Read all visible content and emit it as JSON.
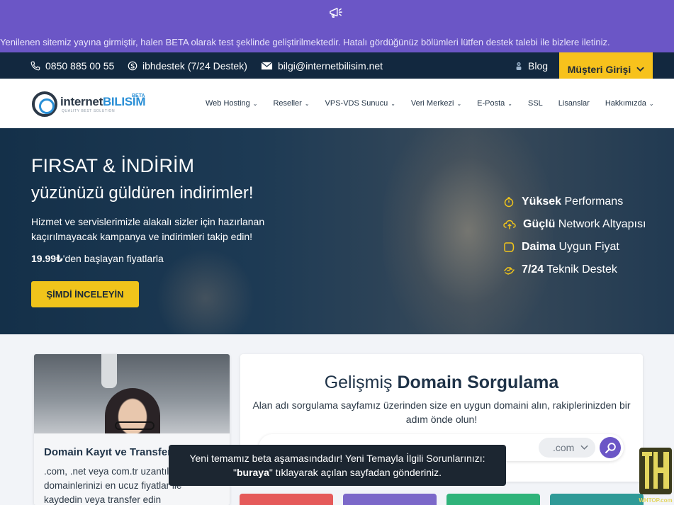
{
  "announcement": {
    "icon": "megaphone-icon",
    "text": "Yenilenen sitemiz yayına girmiştir, halen BETA olarak test şeklinde geliştirilmektedir. Hatalı gördüğünüz bölümleri lütfen destek talebi ile bizlere iletiniz."
  },
  "topbar": {
    "phone": "0850 885 00 55",
    "skype": "ibhdestek (7/24 Destek)",
    "email": "bilgi@internetbilisim.net",
    "blog": "Blog",
    "login": "Müşteri Girişi"
  },
  "logo": {
    "part1": "internet",
    "part2": "BILISIM",
    "beta": "BETA",
    "tagline": "QUALITY BEST SOLUTION"
  },
  "nav": {
    "items": [
      {
        "label": "Web Hosting",
        "dropdown": true
      },
      {
        "label": "Reseller",
        "dropdown": true
      },
      {
        "label": "VPS-VDS Sunucu",
        "dropdown": true
      },
      {
        "label": "Veri Merkezi",
        "dropdown": true
      },
      {
        "label": "E-Posta",
        "dropdown": true
      },
      {
        "label": "SSL",
        "dropdown": false
      },
      {
        "label": "Lisanslar",
        "dropdown": false
      },
      {
        "label": "Hakkımızda",
        "dropdown": true
      }
    ]
  },
  "hero": {
    "title": "FIRSAT & İNDİRİM",
    "subtitle": "yüzünüzü güldüren indirimler!",
    "description": "Hizmet ve servislerimizle alakalı sizler için hazırlanan kaçırılmayacak kampanya ve indirimleri takip edin!",
    "price_value": "19.99₺",
    "price_suffix": "'den başlayan fiyatlarla",
    "button": "ŞİMDİ İNCELEYİN",
    "features": [
      {
        "bold": "Yüksek",
        "text": " Performans",
        "icon": "stopwatch-icon"
      },
      {
        "bold": "Güçlü",
        "text": " Network Altyapısı",
        "icon": "cloud-upload-icon"
      },
      {
        "bold": "Daima",
        "text": " Uygun Fiyat",
        "icon": "tag-icon"
      },
      {
        "bold": "7/24",
        "text": " Teknik Destek",
        "icon": "support-hand-icon"
      }
    ],
    "accent_color": "#f0c41b"
  },
  "domain_card": {
    "title": "Domain Kayıt ve Transfer",
    "text": ".com, .net veya com.tr uzantılı domainlerinizi en ucuz fiyatlar ile kaydedin veya transfer edin"
  },
  "domain_search": {
    "title_light": "Gelişmiş ",
    "title_bold": "Domain Sorgulama",
    "description": "Alan adı sorgulama sayfamız üzerinden size en uygun domaini alın, rakiplerinizden bir adım önde olun!",
    "input_placeholder": "",
    "tld": ".com",
    "brand_color": "#6b56c6"
  },
  "toast": {
    "line1": "Yeni temamız beta aşamasındadır! Yeni Temayla İlgili Sorunlarınızı:",
    "quote_open": "\"",
    "link": "buraya",
    "line2_rest": "\" tıklayarak açılan sayfadan gönderiniz."
  },
  "watermark": {
    "label": "WHTOP.com"
  }
}
